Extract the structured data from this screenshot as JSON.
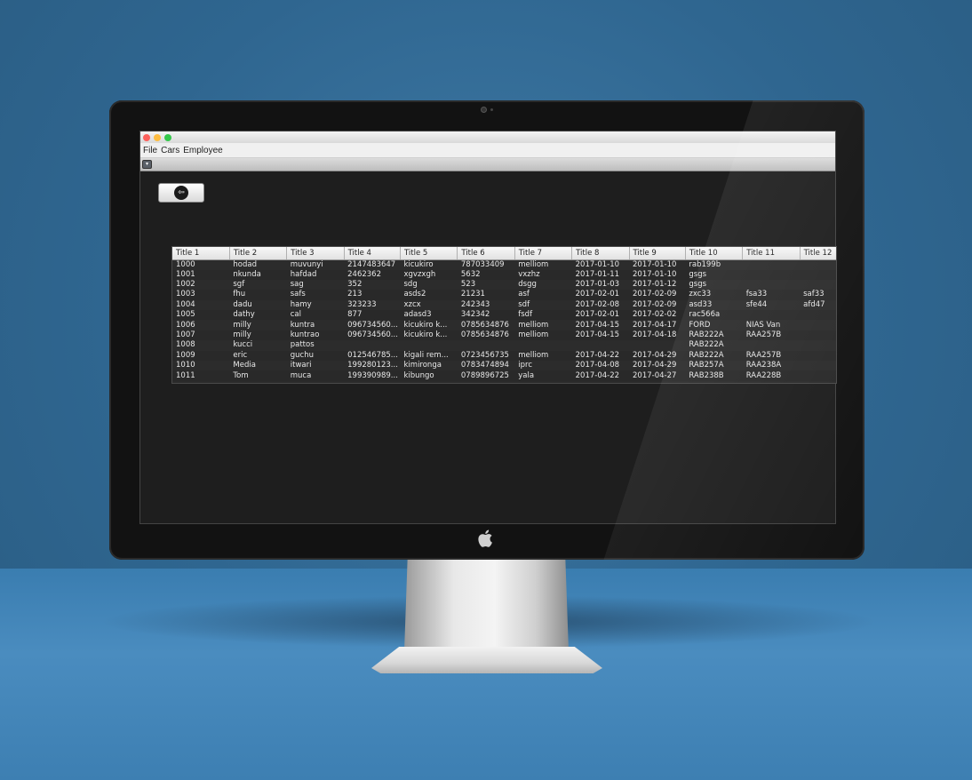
{
  "menu": {
    "items": [
      "File",
      "Cars",
      "Employee"
    ]
  },
  "toolbar": {
    "dropdown_glyph": "▾"
  },
  "back_button": {
    "icon": "arrow-left-icon",
    "glyph": "⇦"
  },
  "table": {
    "columns": [
      "Title 1",
      "Title 2",
      "Title 3",
      "Title 4",
      "Title 5",
      "Title 6",
      "Title 7",
      "Title 8",
      "Title 9",
      "Title 10",
      "Title 11",
      "Title 12"
    ],
    "rows": [
      [
        "1000",
        "hodad",
        "muvunyi",
        "2147483647",
        "kicukiro",
        "787033409",
        "melliom",
        "2017-01-10",
        "2017-01-10",
        "rab199b",
        "",
        ""
      ],
      [
        "1001",
        "nkunda",
        "hafdad",
        "2462362",
        "xgvzxgh",
        "5632",
        "vxzhz",
        "2017-01-11",
        "2017-01-10",
        "gsgs",
        "",
        ""
      ],
      [
        "1002",
        "sgf",
        "sag",
        "352",
        "sdg",
        "523",
        "dsgg",
        "2017-01-03",
        "2017-01-12",
        "gsgs",
        "",
        ""
      ],
      [
        "1003",
        "fhu",
        "safs",
        "213",
        "asds2",
        "21231",
        "asf",
        "2017-02-01",
        "2017-02-09",
        "zxc33",
        "fsa33",
        "saf33"
      ],
      [
        "1004",
        "dadu",
        "hamy",
        "323233",
        "xzcx",
        "242343",
        "sdf",
        "2017-02-08",
        "2017-02-09",
        "asd33",
        "sfe44",
        "afd47"
      ],
      [
        "1005",
        "dathy",
        "cal",
        "877",
        "adasd3",
        "342342",
        "fsdf",
        "2017-02-01",
        "2017-02-02",
        "rac566a",
        "",
        ""
      ],
      [
        "1006",
        "milly",
        "kuntra",
        "096734560...",
        "kicukiro k...",
        "0785634876",
        "melliom",
        "2017-04-15",
        "2017-04-17",
        "FORD",
        "NIAS Van",
        ""
      ],
      [
        "1007",
        "milly",
        "kuntrao",
        "096734560...",
        "kicukiro k...",
        "0785634876",
        "melliom",
        "2017-04-15",
        "2017-04-18",
        "RAB222A",
        "RAA257B",
        ""
      ],
      [
        "1008",
        "kucci",
        "pattos",
        "",
        "",
        "",
        "",
        "",
        "",
        "RAB222A",
        "",
        ""
      ],
      [
        "1009",
        "eric",
        "guchu",
        "012546785...",
        "kigali rem...",
        "0723456735",
        "melliom",
        "2017-04-22",
        "2017-04-29",
        "RAB222A",
        "RAA257B",
        ""
      ],
      [
        "1010",
        "Media",
        "itwari",
        "199280123...",
        "kimironga",
        "0783474894",
        "iprc",
        "2017-04-08",
        "2017-04-29",
        "RAB257A",
        "RAA238A",
        ""
      ],
      [
        "1011",
        "Tom",
        "muca",
        "199390989...",
        "kibungo",
        "0789896725",
        "yala",
        "2017-04-22",
        "2017-04-27",
        "RAB238B",
        "RAA228B",
        ""
      ]
    ]
  }
}
